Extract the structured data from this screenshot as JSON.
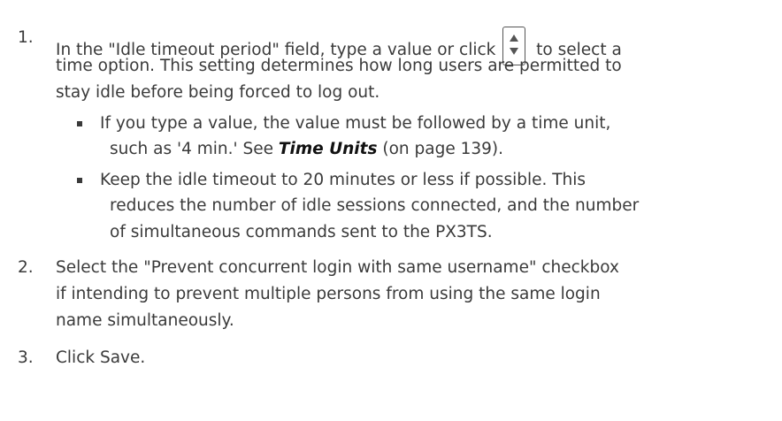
{
  "steps": [
    {
      "number": "1.",
      "line1_before": "In the \"Idle timeout period\" field, type a value or click",
      "spinner_icon": "up-down-spinner-icon",
      "line1_after": "to select a",
      "line2": "time option. This setting determines how long users are permitted to",
      "line3": "stay idle before being forced to log out.",
      "bullets": [
        {
          "line1": "If you type a value, the value must be followed by a time unit,",
          "line2_before": "such as '4 min.' See ",
          "link": "Time Units",
          "line2_after": " (on page 139)."
        },
        {
          "line1": "Keep the idle timeout to 20 minutes or less if possible. This",
          "line2": "reduces the number of idle sessions connected, and the number",
          "line3": "of simultaneous commands sent to the PX3TS."
        }
      ]
    },
    {
      "number": "2.",
      "line1": "Select the \"Prevent concurrent login with same username\" checkbox",
      "line2": "if intending to prevent multiple persons from using the same login",
      "line3": "name simultaneously."
    },
    {
      "number": "3.",
      "line1": "Click Save."
    }
  ]
}
